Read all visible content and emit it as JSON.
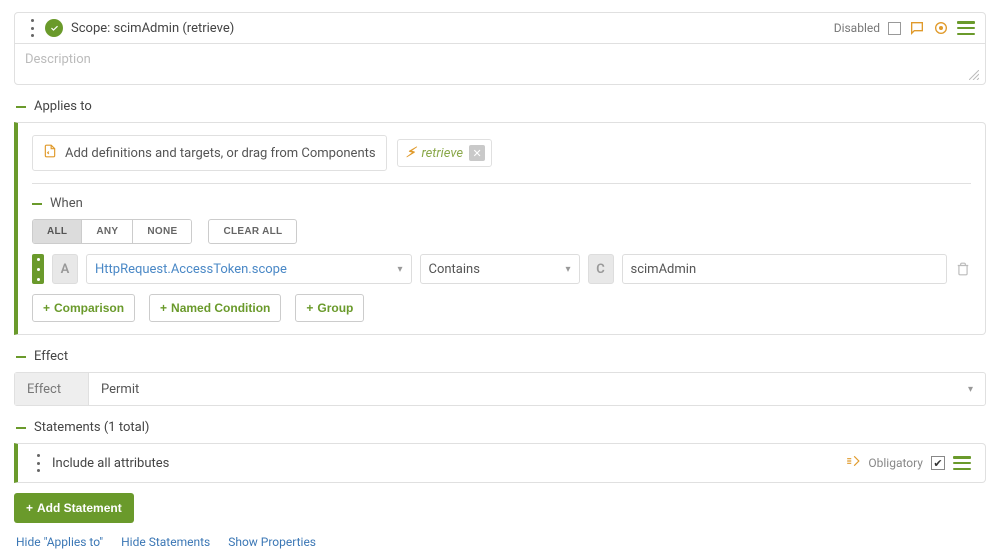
{
  "header": {
    "title": "Scope: scimAdmin (retrieve)",
    "disabled_label": "Disabled",
    "disabled_checked": false
  },
  "description": {
    "placeholder": "Description",
    "value": ""
  },
  "applies_to": {
    "heading": "Applies to",
    "definitions_prompt": "Add definitions and targets, or drag from Components",
    "chips": [
      {
        "label": "retrieve"
      }
    ]
  },
  "when": {
    "heading": "When",
    "logic_options": {
      "all": "ALL",
      "any": "ANY",
      "none": "NONE",
      "active": "all"
    },
    "clear_all": "CLEAR ALL",
    "condition": {
      "left_type": "A",
      "left_token": "HttpRequest.AccessToken.scope",
      "operator": "Contains",
      "right_type": "C",
      "right_value": "scimAdmin"
    },
    "add": {
      "comparison": "Comparison",
      "named_condition": "Named Condition",
      "group": "Group"
    }
  },
  "effect": {
    "heading": "Effect",
    "label": "Effect",
    "value": "Permit"
  },
  "statements": {
    "heading": "Statements (1 total)",
    "items": [
      {
        "title": "Include all attributes",
        "obligatory_label": "Obligatory",
        "obligatory_checked": true
      }
    ],
    "add_statement": "Add Statement"
  },
  "footer": {
    "hide_applies": "Hide \"Applies to\"",
    "hide_statements": "Hide Statements",
    "show_properties": "Show Properties"
  }
}
